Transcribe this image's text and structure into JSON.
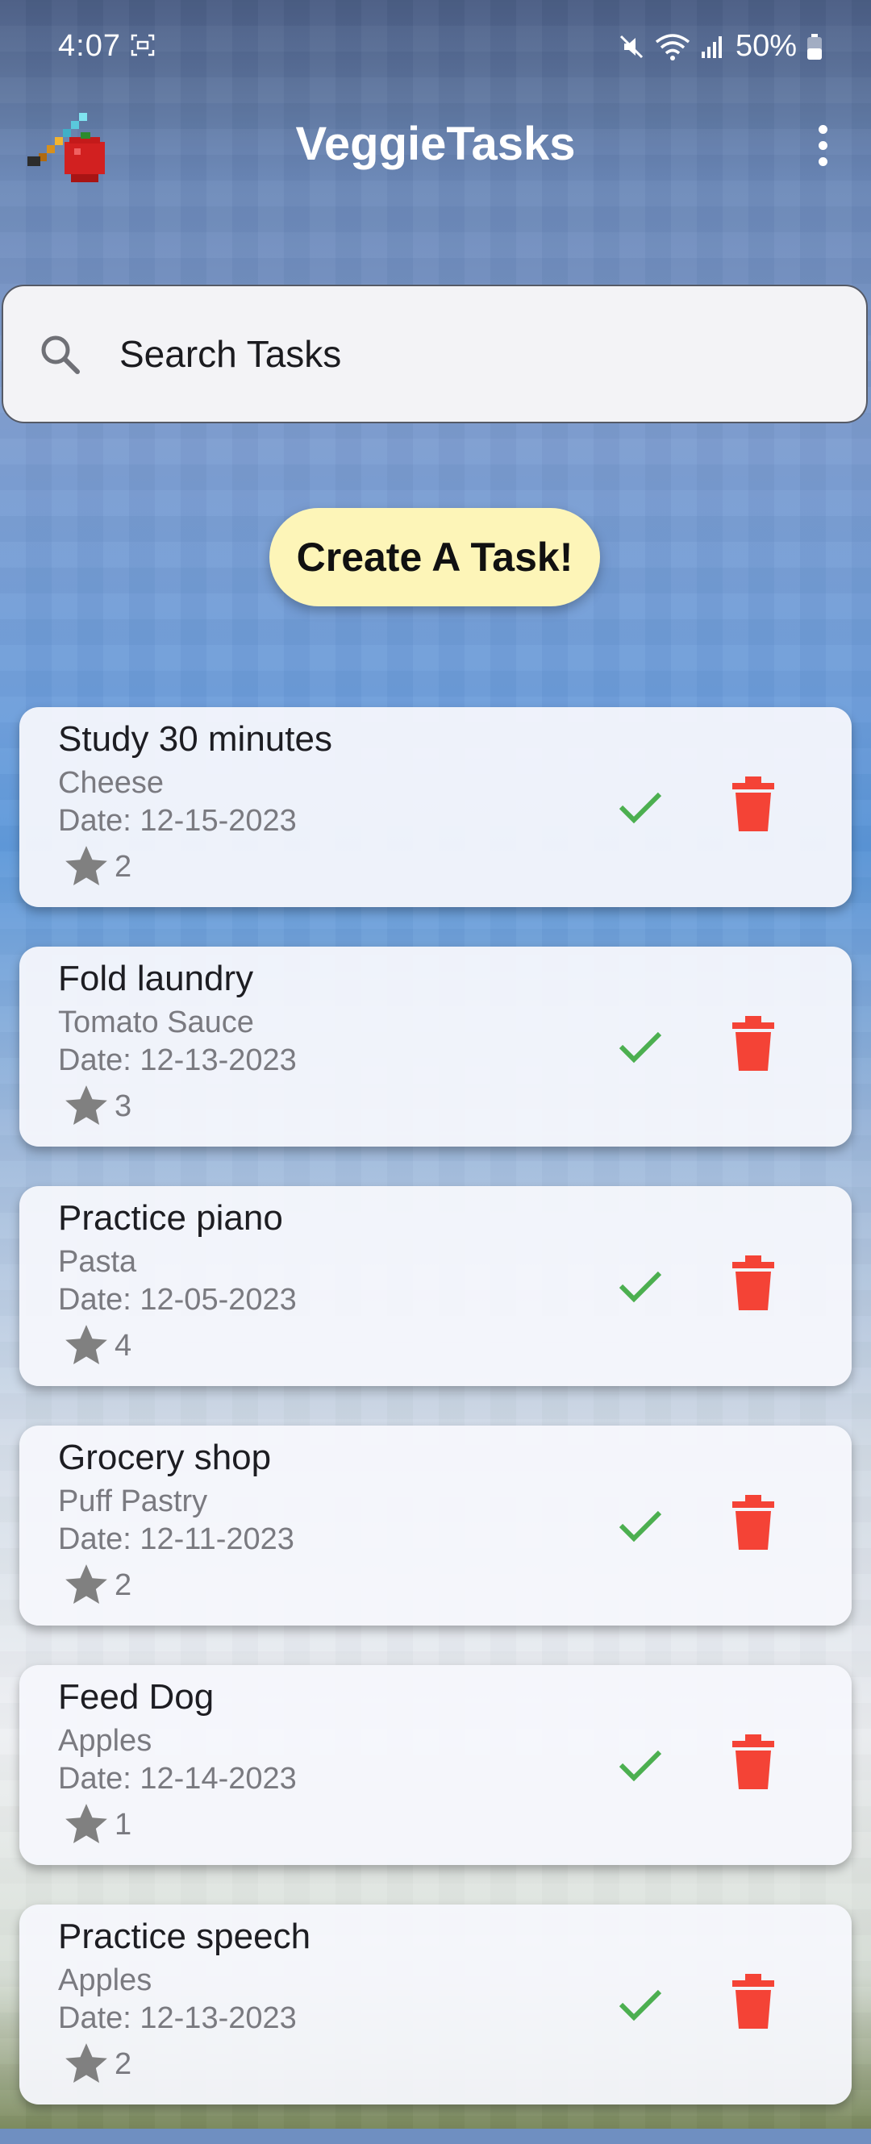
{
  "status_bar": {
    "time": "4:07",
    "battery": "50%",
    "icons": [
      "screen-record-icon",
      "mute-icon",
      "wifi-icon",
      "signal-icon",
      "battery-icon"
    ]
  },
  "app_bar": {
    "title": "VeggieTasks",
    "logo_icon": "veggie-logo-icon",
    "menu_icon": "more-vert-icon"
  },
  "search": {
    "placeholder": "Search Tasks",
    "value": ""
  },
  "create_button_label": "Create A Task!",
  "colors": {
    "accent_button": "#fdf5b8",
    "complete_check": "#4caf50",
    "delete": "#f44336",
    "card_bg": "#f6f7fc"
  },
  "tasks": [
    {
      "title": "Study 30 minutes",
      "ingredient": "Cheese",
      "date": "Date: 12-15-2023",
      "priority": "2"
    },
    {
      "title": "Fold laundry",
      "ingredient": "Tomato Sauce",
      "date": "Date: 12-13-2023",
      "priority": "3"
    },
    {
      "title": "Practice piano",
      "ingredient": "Pasta",
      "date": "Date: 12-05-2023",
      "priority": "4"
    },
    {
      "title": "Grocery shop",
      "ingredient": "Puff Pastry",
      "date": "Date: 12-11-2023",
      "priority": "2"
    },
    {
      "title": "Feed Dog",
      "ingredient": "Apples",
      "date": "Date: 12-14-2023",
      "priority": "1"
    },
    {
      "title": "Practice speech",
      "ingredient": "Apples",
      "date": "Date: 12-13-2023",
      "priority": "2"
    }
  ]
}
